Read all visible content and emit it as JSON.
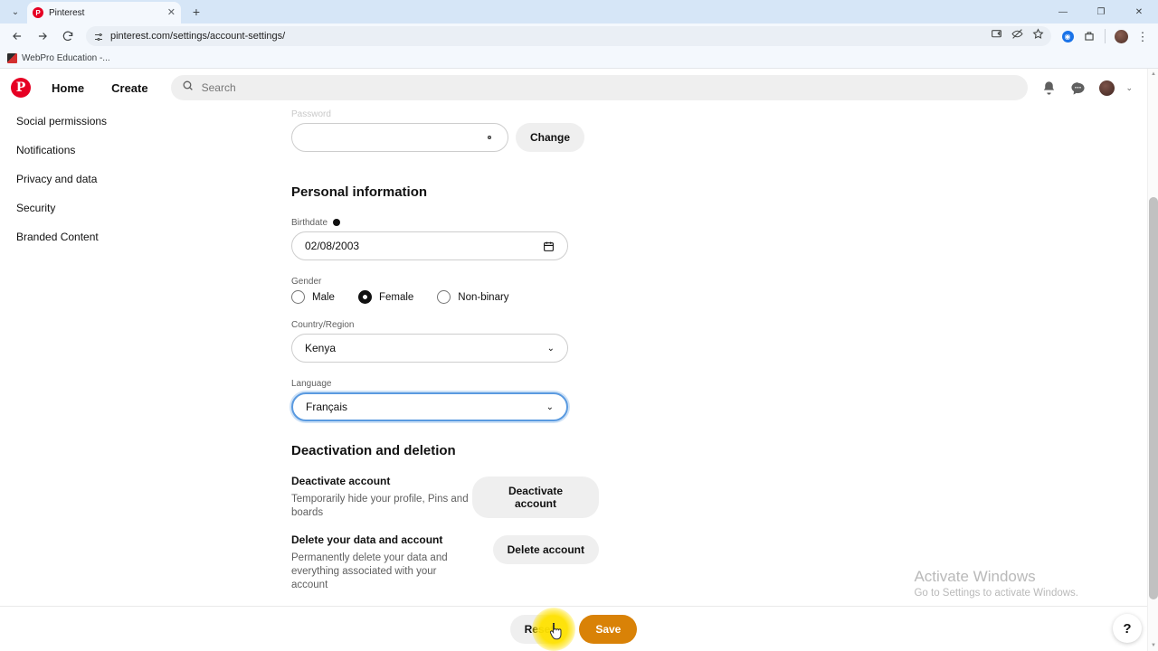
{
  "browser": {
    "tab": {
      "title": "Pinterest",
      "favicon": "pinterest-icon",
      "close": "✕"
    },
    "new_tab_label": "+",
    "tab_list_label": "⌄",
    "window_controls": {
      "minimize": "—",
      "maximize": "❐",
      "close": "✕"
    },
    "url": "pinterest.com/settings/account-settings/",
    "nav": {
      "back": "back-arrow",
      "forward": "forward-arrow",
      "reload": "reload"
    },
    "bookmark": {
      "label": "WebPro Education -..."
    },
    "menu_dots": "⋮"
  },
  "pinterest_header": {
    "logo": "P",
    "links": [
      {
        "label": "Home"
      },
      {
        "label": "Create"
      }
    ],
    "search": {
      "placeholder": "Search"
    },
    "icons": [
      "bell-icon",
      "message-icon",
      "avatar",
      "chevron-down-icon"
    ]
  },
  "sidebar": {
    "items": [
      {
        "label": "Social permissions"
      },
      {
        "label": "Notifications"
      },
      {
        "label": "Privacy and data"
      },
      {
        "label": "Security"
      },
      {
        "label": "Branded Content"
      }
    ]
  },
  "form": {
    "password": {
      "label": "Password",
      "value": "",
      "reveal_icon": "eye-icon",
      "change_button": "Change"
    },
    "personal_information_title": "Personal information",
    "birthdate": {
      "label": "Birthdate",
      "info_icon": "info-icon",
      "value": "02/08/2003",
      "calendar_icon": "calendar-icon"
    },
    "gender": {
      "label": "Gender",
      "options": [
        {
          "label": "Male",
          "selected": false
        },
        {
          "label": "Female",
          "selected": true
        },
        {
          "label": "Non-binary",
          "selected": false
        }
      ]
    },
    "country": {
      "label": "Country/Region",
      "value": "Kenya"
    },
    "language": {
      "label": "Language",
      "value": "Français",
      "focused": true
    }
  },
  "deactivation": {
    "title": "Deactivation and deletion",
    "deactivate": {
      "title": "Deactivate account",
      "description": "Temporarily hide your profile, Pins and boards",
      "button": "Deactivate account"
    },
    "delete": {
      "title": "Delete your data and account",
      "description": "Permanently delete your data and everything associated with your account",
      "button": "Delete account"
    }
  },
  "bottom_bar": {
    "reset_label": "Reset",
    "save_label": "Save",
    "save_color": "#d98207"
  },
  "help_button": {
    "glyph": "?"
  },
  "watermark": {
    "line1": "Activate Windows",
    "line2": "Go to Settings to activate Windows."
  }
}
